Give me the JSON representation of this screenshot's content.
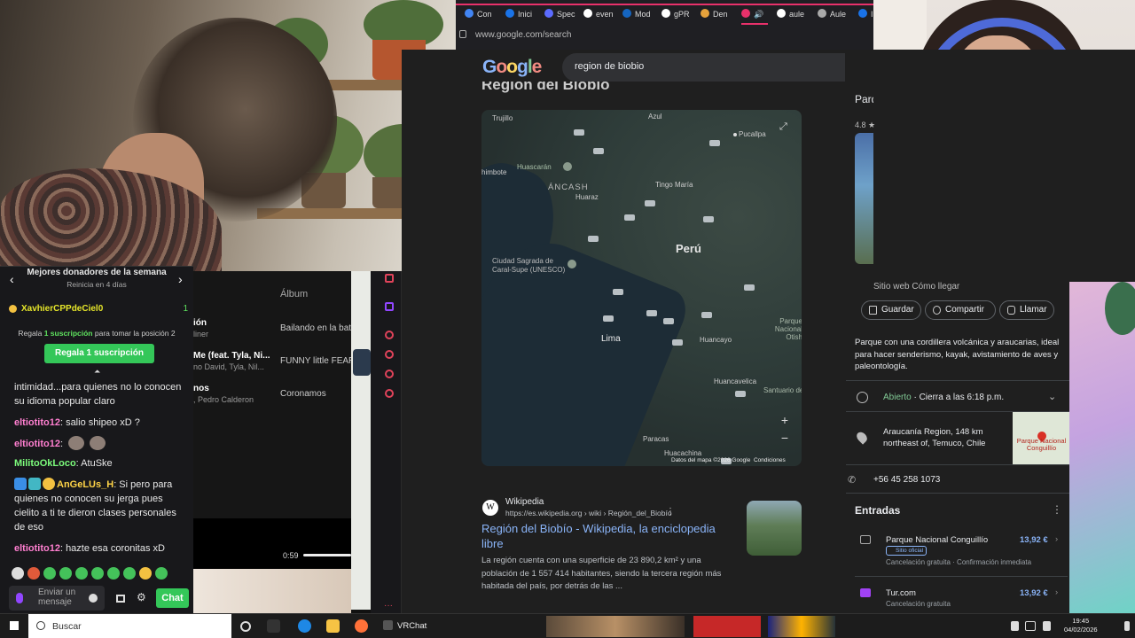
{
  "browser": {
    "tabs": [
      "Con",
      "Inici",
      "Spec",
      "even",
      "Mod",
      "gPR",
      "Den",
      "",
      "aule",
      "Aule",
      "In"
    ],
    "url": "www.google.com/search"
  },
  "google": {
    "logo": "Google",
    "query": "region de biobio",
    "section_title_cut": "Región del Biobío"
  },
  "map": {
    "country": "Perú",
    "labels": [
      "Trujillo",
      "Azul",
      "Pucallpa",
      "Huascarán",
      "himbote",
      "ÁNCASH",
      "Tingo María",
      "Huaraz",
      "Ciudad Sagrada de",
      "Caral-Supe (UNESCO)",
      "Lima",
      "Huancayo",
      "Parque Nacional Otish",
      "Huancavelica",
      "Santuario de",
      "Paracas",
      "Huacachina"
    ],
    "route_shields": [
      "1N",
      "12A",
      "14A",
      "16",
      "3N",
      "18A",
      "22",
      "3N",
      "20A",
      "20",
      "16",
      "22",
      "1N",
      "22A",
      "3S",
      "24",
      "26"
    ],
    "zoom_in": "+",
    "zoom_out": "−",
    "attribution": "Datos del mapa ©2026 Google",
    "terms": "Condiciones"
  },
  "result": {
    "site": "Wikipedia",
    "url": "https://es.wikipedia.org › wiki › Región_del_Biobío",
    "title": "Región del Biobío - Wikipedia, la enciclopedia libre",
    "snippet": "La región cuenta con una superficie de 23 890,2 km² y una población de 1 557 414 habitantes, siendo la tercera región más habitada del país, por detrás de las ..."
  },
  "knowledge_panel": {
    "title_cut": "Parq Con",
    "rating": "4.8 ★",
    "cut_buttons": "Sitio web     Cómo llegar",
    "buttons": [
      "Guardar",
      "Compartir",
      "Llamar"
    ],
    "description": "Parque con una cordillera volcánica y araucarias, ideal para hacer senderismo, kayak, avistamiento de aves y paleontología.",
    "hours_open": "Abierto",
    "hours_close": " · Cierra a las 6:18 p.m.",
    "address": "Araucanía Region, 148 km northeast of, Temuco, Chile",
    "minimap_label": "Parque Nacional Conguillío",
    "phone": "+56 45 258 1073",
    "entradas_title": "Entradas",
    "tickets": [
      {
        "name": "Parque Nacional Conguillío",
        "price": "13,92 €",
        "tag": "Sitio oficial",
        "sub": "Cancelación gratuita · Confirmación inmediata"
      },
      {
        "name": "Tur.com",
        "price": "13,92 €",
        "sub": "Cancelación gratuita"
      }
    ]
  },
  "chat": {
    "top_title": "Mejores donadores de la semana",
    "top_sub": "Reinicia en 4 días",
    "donor_name": "XavhierCPPdeCiel0",
    "donor_count": "1",
    "gift_note_pre": "Regala ",
    "gift_note_hl": "1 suscripción",
    "gift_note_post": " para tomar la posición 2",
    "gift_button": "Regala 1 suscripción",
    "messages": [
      {
        "user": "",
        "text": "intimidad...para quienes no lo conocen su idioma popular claro",
        "color": "#e8e8e8"
      },
      {
        "user": "eltiotito12",
        "text": ": salio shipeo xD ?",
        "color": "#ff7fd0"
      },
      {
        "user": "eltiotito12",
        "text": ":",
        "color": "#ff7fd0"
      },
      {
        "user": "MilitoOkLoco",
        "text": ": AtuSke",
        "color": "#7cfc7c"
      },
      {
        "user": "AnGeLUs_H",
        "text": ": Si pero para quienes no conocen su jerga pues cielito a ti te dieron clases personales de eso",
        "color": "#ffd447"
      },
      {
        "user": "eltiotito12",
        "text": ": hazte esa coronitas xD",
        "color": "#ff7fd0"
      }
    ],
    "input_placeholder": "Enviar un mensaje",
    "chat_button": "Chat"
  },
  "music": {
    "header_album": "Álbum",
    "rows": [
      {
        "title": "ión",
        "sub": "liner",
        "album": "Bailando en la bata"
      },
      {
        "title": "Me (feat. Tyla, Ni...",
        "sub": "no David, Tyla, Nil...",
        "album": "FUNNY little FEARS"
      },
      {
        "title": "nos",
        "sub": ", Pedro Calderon",
        "album": "Coronamos"
      }
    ],
    "time": "0:59"
  },
  "taskbar": {
    "search_placeholder": "Buscar",
    "vrchat": "VRChat",
    "time": "19:45",
    "date": "04/02/2026"
  },
  "colors": {
    "accent_green": "#34c759",
    "google_blue_link": "#8ab4f8",
    "open_green": "#81c995",
    "tab_accent": "#e8316b"
  }
}
